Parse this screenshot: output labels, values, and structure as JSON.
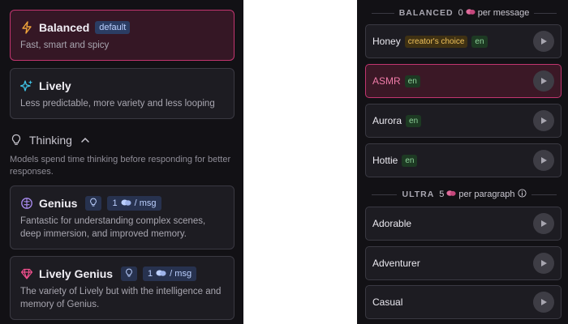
{
  "left": {
    "models": [
      {
        "name": "Balanced",
        "badge": "default",
        "desc": "Fast, smart and spicy",
        "selected": true
      },
      {
        "name": "Lively",
        "desc": "Less predictable, more variety and less looping",
        "selected": false
      }
    ],
    "thinking": {
      "title": "Thinking",
      "desc": "Models spend time thinking before responding for better responses."
    },
    "thinking_models": [
      {
        "name": "Genius",
        "cost": "1",
        "unit": "/ msg",
        "desc": "Fantastic for understanding complex scenes, deep immersion, and improved memory."
      },
      {
        "name": "Lively Genius",
        "cost": "1",
        "unit": "/ msg",
        "desc": "The variety of Lively but with the intelligence and memory of Genius."
      }
    ]
  },
  "right": {
    "balanced": {
      "name": "BALANCED",
      "cost": "0",
      "unit": "per message"
    },
    "balanced_voices": [
      {
        "name": "Honey",
        "choice": "creator's choice",
        "lang": "en"
      },
      {
        "name": "ASMR",
        "lang": "en",
        "selected": true
      },
      {
        "name": "Aurora",
        "lang": "en"
      },
      {
        "name": "Hottie",
        "lang": "en"
      }
    ],
    "ultra": {
      "name": "ULTRA",
      "cost": "5",
      "unit": "per paragraph"
    },
    "ultra_voices": [
      {
        "name": "Adorable"
      },
      {
        "name": "Adventurer"
      },
      {
        "name": "Casual"
      }
    ]
  },
  "colors": {
    "accent": "#c2356f",
    "panel": "#121115",
    "card": "#1d1c22"
  }
}
